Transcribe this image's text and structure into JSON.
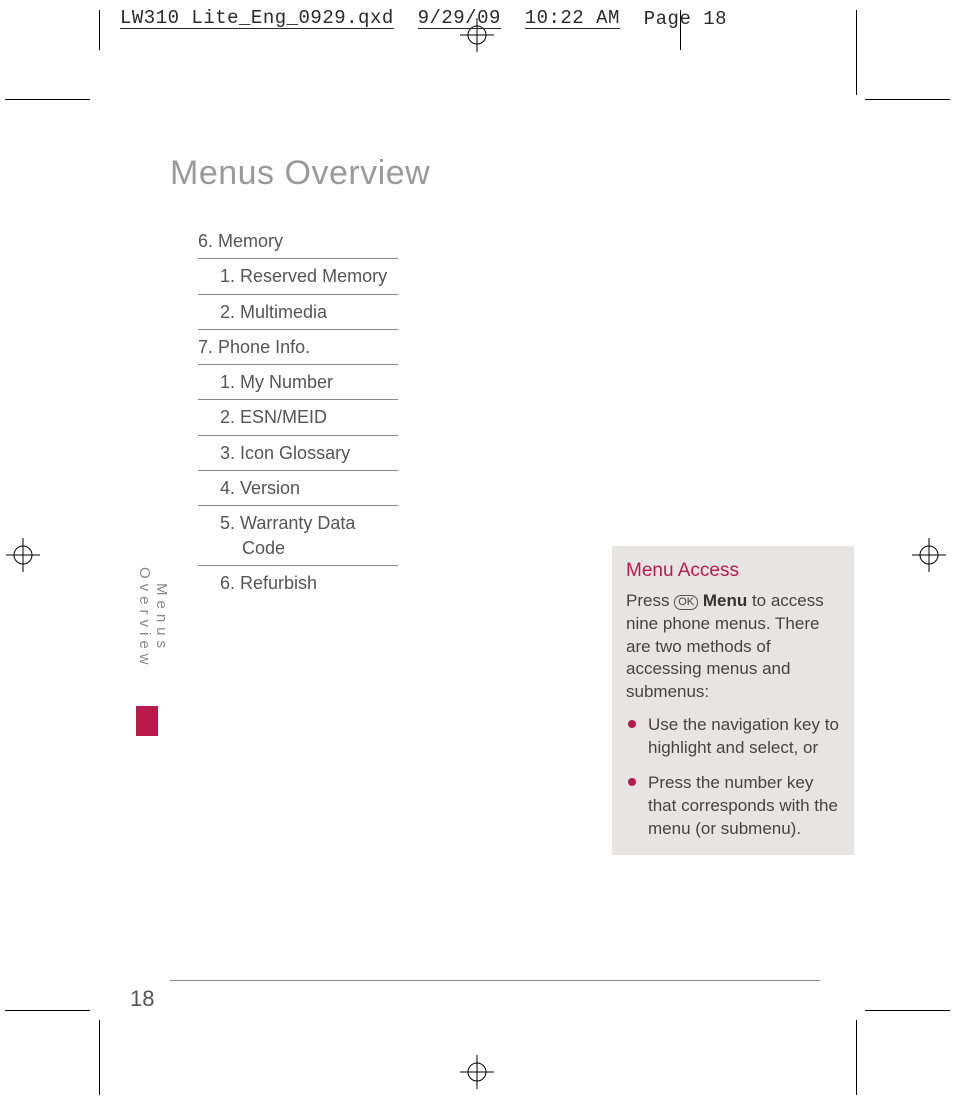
{
  "slug": {
    "file": "LW310 Lite_Eng_0929.qxd",
    "date": "9/29/09",
    "time": "10:22 AM",
    "page_label": "Page 18"
  },
  "title": "Menus Overview",
  "side_tab": "Menus Overview",
  "page_number": "18",
  "menu": {
    "sections": [
      {
        "num": "6.",
        "label": "Memory",
        "items": [
          {
            "num": "1.",
            "label": "Reserved Memory"
          },
          {
            "num": "2.",
            "label": "Multimedia"
          }
        ]
      },
      {
        "num": "7.",
        "label": "Phone Info.",
        "items": [
          {
            "num": "1.",
            "label": "My Number"
          },
          {
            "num": "2.",
            "label": "ESN/MEID"
          },
          {
            "num": "3.",
            "label": "Icon Glossary"
          },
          {
            "num": "4.",
            "label": "Version"
          },
          {
            "num": "5.",
            "label": "Warranty Data Code"
          },
          {
            "num": "6.",
            "label": "Refurbish"
          }
        ]
      }
    ]
  },
  "callout": {
    "title": "Menu Access",
    "intro_pre": "Press ",
    "ok": "OK",
    "intro_bold": " Menu ",
    "intro_post": "to access nine phone menus. There are two methods of accessing menus and submenus:",
    "bullets": [
      "Use the navigation key to highlight and select, or",
      "Press the number key that corresponds with the menu (or submenu)."
    ]
  }
}
